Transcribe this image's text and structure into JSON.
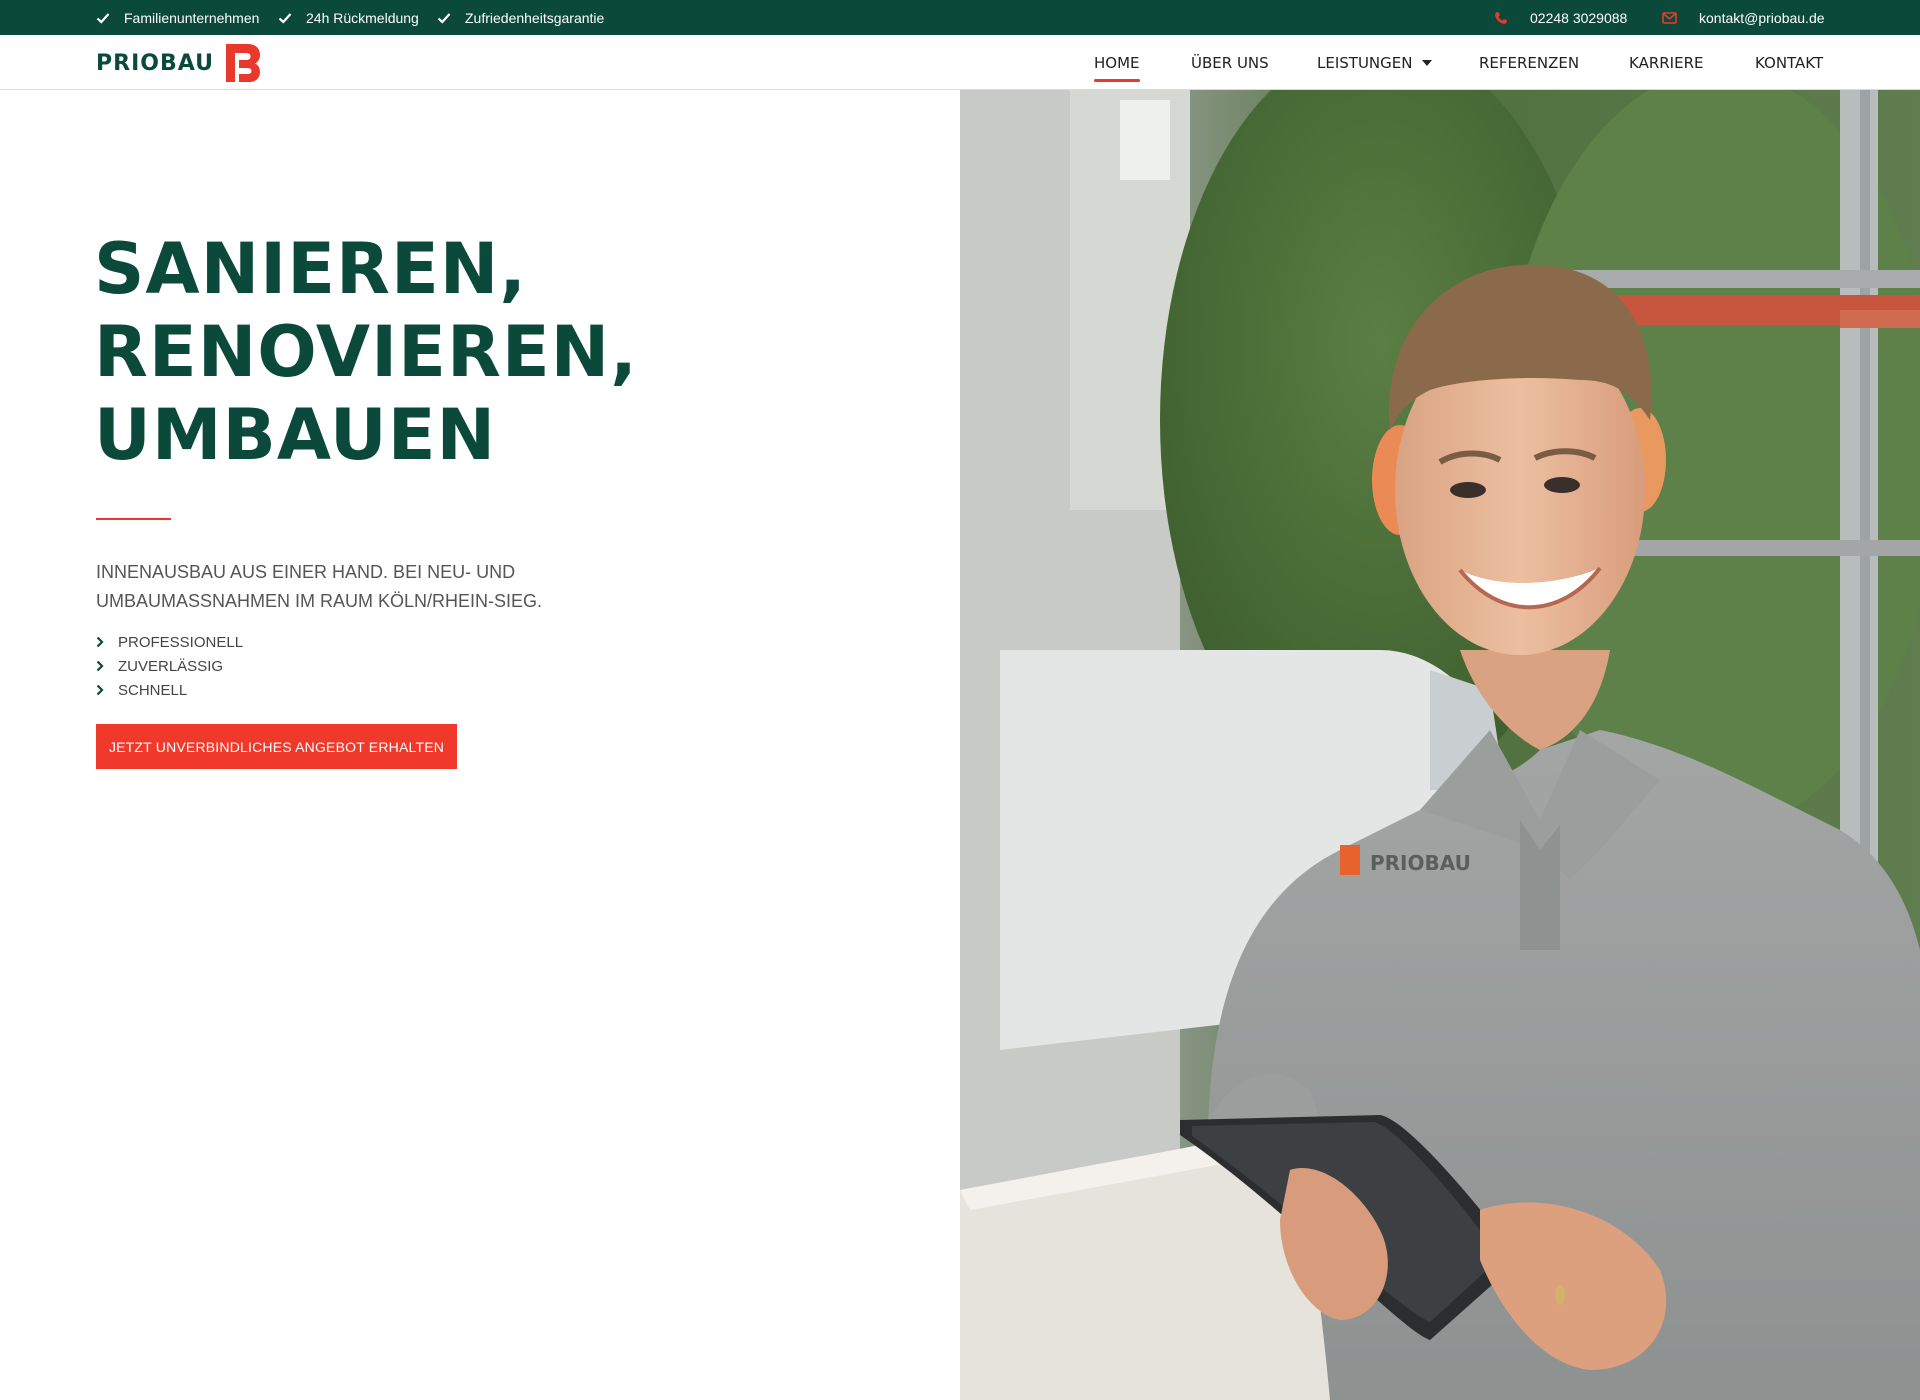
{
  "topbar": {
    "usps": [
      "Familienunternehmen",
      "24h Rückmeldung",
      "Zufriedenheitsgarantie"
    ],
    "phone": "02248 3029088",
    "email": "kontakt@priobau.de"
  },
  "header": {
    "logo_text": "PRIOBAU",
    "nav": [
      "HOME",
      "ÜBER UNS",
      "LEISTUNGEN",
      "REFERENZEN",
      "KARRIERE",
      "KONTAKT"
    ]
  },
  "hero": {
    "title_lines": [
      "SANIEREN,",
      "RENOVIEREN,",
      "UMBAUEN"
    ],
    "subline_1": "INNENAUSBAU AUS EINER HAND. BEI NEU- UND",
    "subline_2": "UMBAUMASSNAHMEN IM RAUM KÖLN/RHEIN-SIEG.",
    "features": [
      "PROFESSIONELL",
      "ZUVERLÄSSIG",
      "SCHNELL"
    ],
    "cta_label": "JETZT UNVERBINDLICHES ANGEBOT ERHALTEN",
    "shirt_logo_text": "PRIOBAU"
  },
  "colors": {
    "brand_green": "#0b4a3a",
    "accent_red": "#e8392c"
  },
  "icons": {
    "usp": "check-icon",
    "phone": "phone-icon",
    "email": "envelope-icon",
    "feature": "chevron-right-icon",
    "nav_dropdown": "caret-down-icon"
  }
}
